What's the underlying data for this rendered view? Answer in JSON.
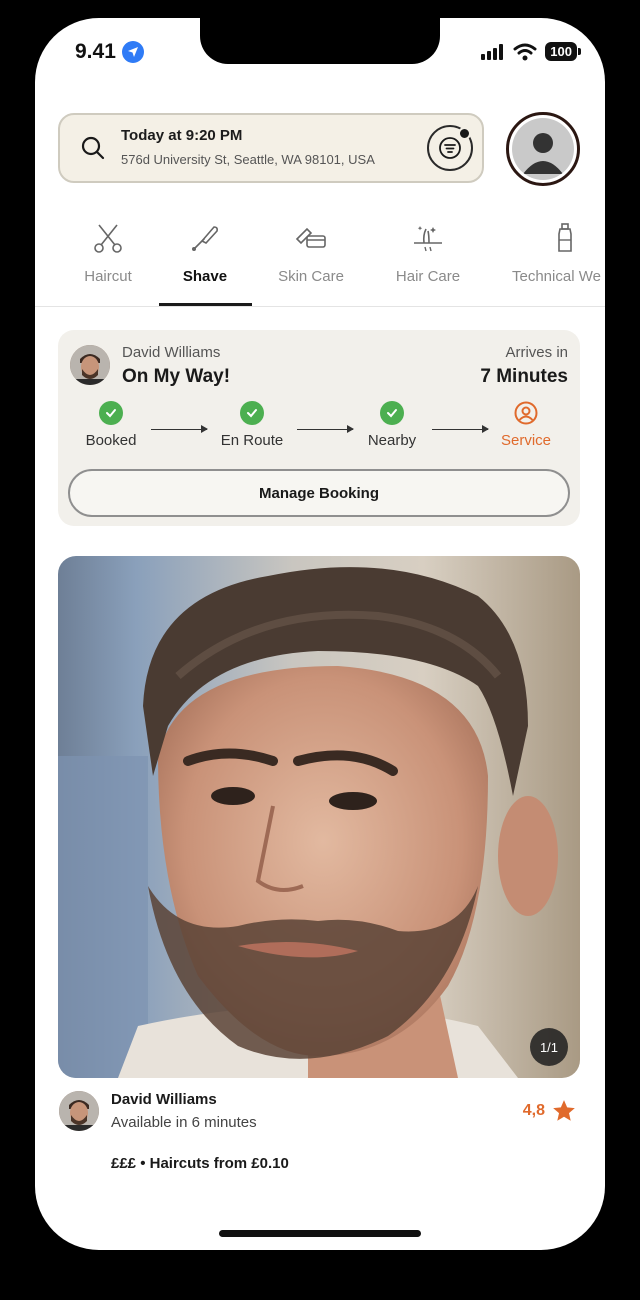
{
  "status_bar": {
    "time": "9.41",
    "battery": "100"
  },
  "search": {
    "title": "Today at 9:20 PM",
    "address": "576d University St, Seattle, WA 98101, USA"
  },
  "categories": [
    {
      "label": "Haircut",
      "icon": "scissors-icon"
    },
    {
      "label": "Shave",
      "icon": "razor-icon",
      "active": true
    },
    {
      "label": "Skin Care",
      "icon": "skin-care-icon"
    },
    {
      "label": "Hair Care",
      "icon": "hair-care-icon"
    },
    {
      "label": "Technical We",
      "icon": "bottle-icon"
    }
  ],
  "tracking": {
    "barber_name": "David Williams",
    "status": "On My Way!",
    "arrives_label": "Arrives in",
    "arrives_value": "7 Minutes",
    "steps": [
      {
        "label": "Booked",
        "state": "done"
      },
      {
        "label": "En Route",
        "state": "done"
      },
      {
        "label": "Nearby",
        "state": "done"
      },
      {
        "label": "Service",
        "state": "current"
      }
    ],
    "manage_label": "Manage Booking"
  },
  "photo": {
    "counter": "1/1"
  },
  "barber": {
    "name": "David Williams",
    "availability": "Available in 6 minutes",
    "rating": "4,8",
    "price_line": "£££ • Haircuts from £0.10"
  },
  "colors": {
    "accent": "#e06a2c",
    "check": "#4caf50",
    "dark": "#2b1712"
  }
}
